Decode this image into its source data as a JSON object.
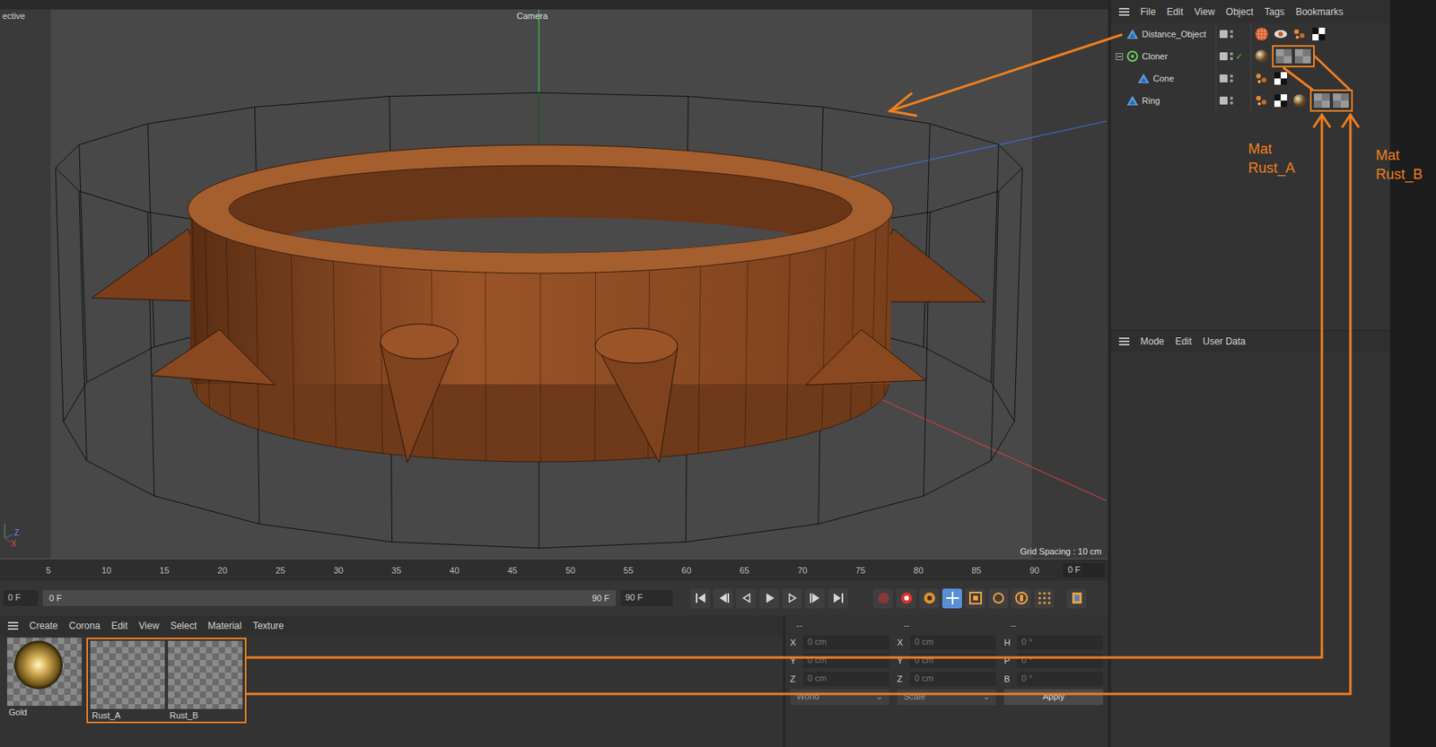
{
  "viewport": {
    "label": "ective",
    "camera": "Camera",
    "grid_spacing": "Grid Spacing : 10 cm",
    "axes": [
      "Z",
      "X"
    ]
  },
  "object_manager": {
    "menu": [
      "File",
      "Edit",
      "View",
      "Object",
      "Tags",
      "Bookmarks"
    ],
    "objects": [
      {
        "name": "Distance_Object",
        "kind": "polygon",
        "depth": 0,
        "has_children": false,
        "expanded": false,
        "generator_on": false,
        "tags": [
          {
            "kind": "texture"
          },
          {
            "kind": "display"
          },
          {
            "kind": "phong"
          },
          {
            "kind": "uv"
          }
        ],
        "annotated_tags": []
      },
      {
        "name": "Cloner",
        "kind": "cloner",
        "depth": 0,
        "has_children": true,
        "expanded": true,
        "generator_on": true,
        "tags": [
          {
            "kind": "sphere"
          }
        ],
        "annotated_tags": [
          {
            "kind": "material"
          },
          {
            "kind": "material"
          }
        ]
      },
      {
        "name": "Cone",
        "kind": "polygon",
        "depth": 1,
        "has_children": false,
        "expanded": false,
        "generator_on": false,
        "tags": [
          {
            "kind": "phong"
          },
          {
            "kind": "uv"
          }
        ],
        "annotated_tags": []
      },
      {
        "name": "Ring",
        "kind": "polygon",
        "depth": 0,
        "has_children": false,
        "expanded": false,
        "generator_on": false,
        "tags": [
          {
            "kind": "phong"
          },
          {
            "kind": "uv"
          },
          {
            "kind": "sphere"
          }
        ],
        "annotated_tags": [
          {
            "kind": "material"
          },
          {
            "kind": "material"
          }
        ]
      }
    ]
  },
  "attribute_manager": {
    "menu": [
      "Mode",
      "Edit",
      "User Data"
    ]
  },
  "timeline": {
    "ticks": [
      "5",
      "10",
      "15",
      "20",
      "25",
      "30",
      "35",
      "40",
      "45",
      "50",
      "55",
      "60",
      "65",
      "70",
      "75",
      "80",
      "85",
      "90"
    ],
    "current": "0 F",
    "start": "0 F",
    "range_start": "0 F",
    "range_end": "90 F",
    "end": "90 F",
    "buttons": [
      {
        "kind": "first",
        "selected": false
      },
      {
        "kind": "prev-key",
        "selected": false
      },
      {
        "kind": "prev",
        "selected": false
      },
      {
        "kind": "play",
        "selected": false
      },
      {
        "kind": "next",
        "selected": false
      },
      {
        "kind": "next-key",
        "selected": false
      },
      {
        "kind": "last",
        "selected": false
      },
      {
        "kind": "record",
        "selected": false
      },
      {
        "kind": "autokey",
        "selected": false
      },
      {
        "kind": "keyframe",
        "selected": false
      },
      {
        "kind": "move",
        "selected": true
      },
      {
        "kind": "scale",
        "selected": false
      },
      {
        "kind": "rotate",
        "selected": false
      },
      {
        "kind": "param",
        "selected": false
      },
      {
        "kind": "dots",
        "selected": false
      },
      {
        "kind": "film",
        "selected": false
      }
    ]
  },
  "materials": {
    "menu": [
      "Create",
      "Corona",
      "Edit",
      "View",
      "Select",
      "Material",
      "Texture"
    ],
    "items": [
      {
        "name": "Gold",
        "kind": "gold",
        "annotated": false
      },
      {
        "name": "Rust_A",
        "kind": "empty",
        "annotated": true
      },
      {
        "name": "Rust_B",
        "kind": "empty",
        "annotated": true
      }
    ]
  },
  "coordinates": {
    "headers": [
      "--",
      "--",
      "--"
    ],
    "disabled": true,
    "rows": [
      {
        "cells": [
          {
            "axis": "X",
            "value": "0 cm"
          },
          {
            "axis": "X",
            "value": "0 cm"
          },
          {
            "axis": "H",
            "value": "0 °"
          }
        ]
      },
      {
        "cells": [
          {
            "axis": "Y",
            "value": "0 cm"
          },
          {
            "axis": "Y",
            "value": "0 cm"
          },
          {
            "axis": "P",
            "value": "0 °"
          }
        ]
      },
      {
        "cells": [
          {
            "axis": "Z",
            "value": "0 cm"
          },
          {
            "axis": "Z",
            "value": "0 cm"
          },
          {
            "axis": "B",
            "value": "0 °"
          }
        ]
      }
    ],
    "dropdowns": [
      "World",
      "Scale"
    ],
    "apply": "Apply"
  },
  "annotations": {
    "labels": [
      {
        "lines": [
          "Mat",
          "Rust_A"
        ]
      },
      {
        "lines": [
          "Mat",
          "Rust_B"
        ]
      }
    ]
  }
}
